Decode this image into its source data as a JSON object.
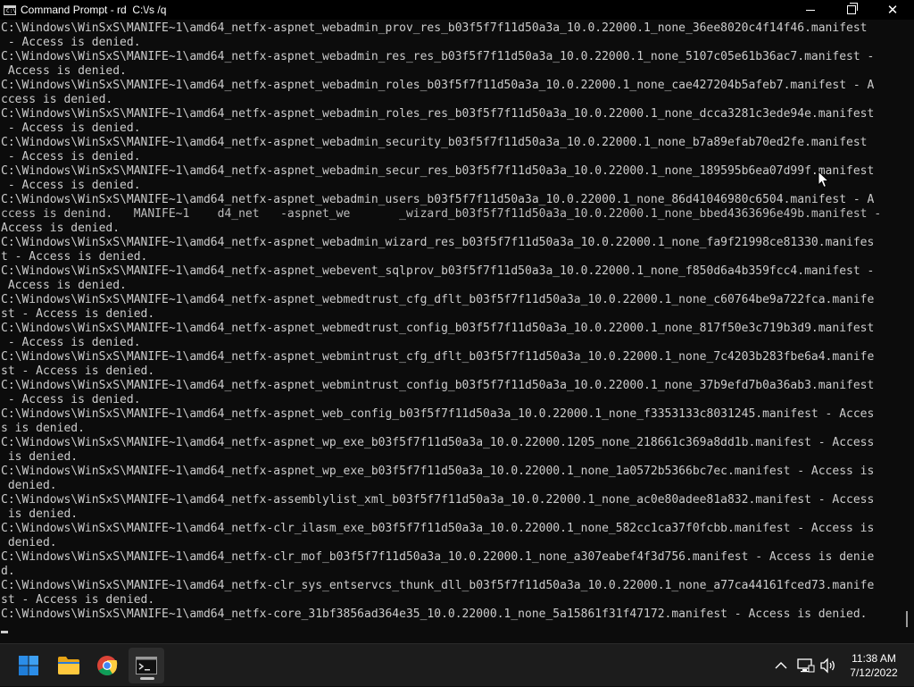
{
  "window": {
    "title": "Command Prompt - rd  C:\\/s /q",
    "icon_text": "C:\\"
  },
  "console": {
    "lines": [
      "C:\\Windows\\WinSxS\\MANIFE~1\\amd64_netfx-aspnet_webadmin_prov_res_b03f5f7f11d50a3a_10.0.22000.1_none_36ee8020c4f14f46.manifest",
      " - Access is denied.",
      "C:\\Windows\\WinSxS\\MANIFE~1\\amd64_netfx-aspnet_webadmin_res_res_b03f5f7f11d50a3a_10.0.22000.1_none_5107c05e61b36ac7.manifest -",
      " Access is denied.",
      "C:\\Windows\\WinSxS\\MANIFE~1\\amd64_netfx-aspnet_webadmin_roles_b03f5f7f11d50a3a_10.0.22000.1_none_cae427204b5afeb7.manifest - A",
      "ccess is denied.",
      "C:\\Windows\\WinSxS\\MANIFE~1\\amd64_netfx-aspnet_webadmin_roles_res_b03f5f7f11d50a3a_10.0.22000.1_none_dcca3281c3ede94e.manifest",
      " - Access is denied.",
      "C:\\Windows\\WinSxS\\MANIFE~1\\amd64_netfx-aspnet_webadmin_security_b03f5f7f11d50a3a_10.0.22000.1_none_b7a89efab70ed2fe.manifest",
      " - Access is denied.",
      "C:\\Windows\\WinSxS\\MANIFE~1\\amd64_netfx-aspnet_webadmin_secur_res_b03f5f7f11d50a3a_10.0.22000.1_none_189595b6ea07d99f.manifest",
      " - Access is denied.",
      "C:\\Windows\\WinSxS\\MANIFE~1\\amd64_netfx-aspnet_webadmin_users_b03f5f7f11d50a3a_10.0.22000.1_none_86d41046980c6504.manifest - A",
      "ccess is denind.   MANIFE~1    d4_net   -aspnet_we       _wizard_b03f5f7f11d50a3a_10.0.22000.1_none_bbed4363696e49b.manifest -",
      "Access is denied.",
      "C:\\Windows\\WinSxS\\MANIFE~1\\amd64_netfx-aspnet_webadmin_wizard_res_b03f5f7f11d50a3a_10.0.22000.1_none_fa9f21998ce81330.manifes",
      "t - Access is denied.",
      "C:\\Windows\\WinSxS\\MANIFE~1\\amd64_netfx-aspnet_webevent_sqlprov_b03f5f7f11d50a3a_10.0.22000.1_none_f850d6a4b359fcc4.manifest -",
      " Access is denied.",
      "C:\\Windows\\WinSxS\\MANIFE~1\\amd64_netfx-aspnet_webmedtrust_cfg_dflt_b03f5f7f11d50a3a_10.0.22000.1_none_c60764be9a722fca.manife",
      "st - Access is denied.",
      "C:\\Windows\\WinSxS\\MANIFE~1\\amd64_netfx-aspnet_webmedtrust_config_b03f5f7f11d50a3a_10.0.22000.1_none_817f50e3c719b3d9.manifest",
      " - Access is denied.",
      "C:\\Windows\\WinSxS\\MANIFE~1\\amd64_netfx-aspnet_webmintrust_cfg_dflt_b03f5f7f11d50a3a_10.0.22000.1_none_7c4203b283fbe6a4.manife",
      "st - Access is denied.",
      "C:\\Windows\\WinSxS\\MANIFE~1\\amd64_netfx-aspnet_webmintrust_config_b03f5f7f11d50a3a_10.0.22000.1_none_37b9efd7b0a36ab3.manifest",
      " - Access is denied.",
      "C:\\Windows\\WinSxS\\MANIFE~1\\amd64_netfx-aspnet_web_config_b03f5f7f11d50a3a_10.0.22000.1_none_f3353133c8031245.manifest - Acces",
      "s is denied.",
      "C:\\Windows\\WinSxS\\MANIFE~1\\amd64_netfx-aspnet_wp_exe_b03f5f7f11d50a3a_10.0.22000.1205_none_218661c369a8dd1b.manifest - Access",
      " is denied.",
      "C:\\Windows\\WinSxS\\MANIFE~1\\amd64_netfx-aspnet_wp_exe_b03f5f7f11d50a3a_10.0.22000.1_none_1a0572b5366bc7ec.manifest - Access is",
      " denied.",
      "C:\\Windows\\WinSxS\\MANIFE~1\\amd64_netfx-assemblylist_xml_b03f5f7f11d50a3a_10.0.22000.1_none_ac0e80adee81a832.manifest - Access",
      " is denied.",
      "C:\\Windows\\WinSxS\\MANIFE~1\\amd64_netfx-clr_ilasm_exe_b03f5f7f11d50a3a_10.0.22000.1_none_582cc1ca37f0fcbb.manifest - Access is",
      " denied.",
      "C:\\Windows\\WinSxS\\MANIFE~1\\amd64_netfx-clr_mof_b03f5f7f11d50a3a_10.0.22000.1_none_a307eabef4f3d756.manifest - Access is denie",
      "d.",
      "C:\\Windows\\WinSxS\\MANIFE~1\\amd64_netfx-clr_sys_entservcs_thunk_dll_b03f5f7f11d50a3a_10.0.22000.1_none_a77ca44161fced73.manife",
      "st - Access is denied.",
      "C:\\Windows\\WinSxS\\MANIFE~1\\amd64_netfx-core_31bf3856ad364e35_10.0.22000.1_none_5a15861f31f47172.manifest - Access is denied."
    ]
  },
  "taskbar": {
    "apps": [
      {
        "name": "start",
        "icon": "windows-logo-icon"
      },
      {
        "name": "file-explorer",
        "icon": "folder-icon"
      },
      {
        "name": "chrome",
        "icon": "chrome-icon"
      },
      {
        "name": "command-prompt",
        "icon": "terminal-icon",
        "active": true
      }
    ],
    "tray": {
      "time": "11:38 AM",
      "date": "7/12/2022"
    }
  },
  "colors": {
    "console_bg": "#0c0c0c",
    "console_fg": "#cccccc",
    "titlebar_bg": "#000000",
    "taskbar_bg": "#1c1c1c",
    "start_blue": "#2b8de8"
  }
}
